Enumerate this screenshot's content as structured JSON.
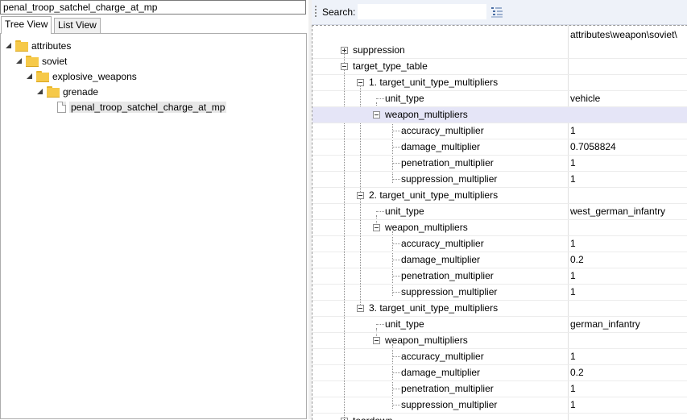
{
  "file_name_field": {
    "value": "penal_troop_satchel_charge_at_mp"
  },
  "tabs": [
    {
      "label": "Tree View",
      "active": true
    },
    {
      "label": "List View",
      "active": false
    }
  ],
  "tree": [
    {
      "label": "attributes",
      "type": "folder",
      "expanded": true
    },
    {
      "label": "soviet",
      "type": "folder",
      "expanded": true
    },
    {
      "label": "explosive_weapons",
      "type": "folder",
      "expanded": true
    },
    {
      "label": "grenade",
      "type": "folder",
      "expanded": true
    },
    {
      "label": "penal_troop_satchel_charge_at_mp",
      "type": "file",
      "selected": true
    }
  ],
  "search": {
    "label": "Search:",
    "value": ""
  },
  "grid": {
    "path_header": "attributes\\weapon\\soviet\\",
    "rows": [
      {
        "name": "suppression",
        "value": ""
      },
      {
        "name": "target_type_table",
        "value": ""
      },
      {
        "name": "1. target_unit_type_multipliers",
        "value": ""
      },
      {
        "name": "unit_type",
        "value": "vehicle"
      },
      {
        "name": "weapon_multipliers",
        "value": ""
      },
      {
        "name": "accuracy_multiplier",
        "value": "1"
      },
      {
        "name": "damage_multiplier",
        "value": "0.7058824"
      },
      {
        "name": "penetration_multiplier",
        "value": "1"
      },
      {
        "name": "suppression_multiplier",
        "value": "1"
      },
      {
        "name": "2. target_unit_type_multipliers",
        "value": ""
      },
      {
        "name": "unit_type",
        "value": "west_german_infantry"
      },
      {
        "name": "weapon_multipliers",
        "value": ""
      },
      {
        "name": "accuracy_multiplier",
        "value": "1"
      },
      {
        "name": "damage_multiplier",
        "value": "0.2"
      },
      {
        "name": "penetration_multiplier",
        "value": "1"
      },
      {
        "name": "suppression_multiplier",
        "value": "1"
      },
      {
        "name": "3. target_unit_type_multipliers",
        "value": ""
      },
      {
        "name": "unit_type",
        "value": "german_infantry"
      },
      {
        "name": "weapon_multipliers",
        "value": ""
      },
      {
        "name": "accuracy_multiplier",
        "value": "1"
      },
      {
        "name": "damage_multiplier",
        "value": "0.2"
      },
      {
        "name": "penetration_multiplier",
        "value": "1"
      },
      {
        "name": "suppression_multiplier",
        "value": "1"
      },
      {
        "name": "teardown",
        "value": ""
      }
    ]
  },
  "colors": {
    "selected_row": "#e5e5f7",
    "folder": "#f6c949",
    "toolbar": "#eef2f9"
  }
}
